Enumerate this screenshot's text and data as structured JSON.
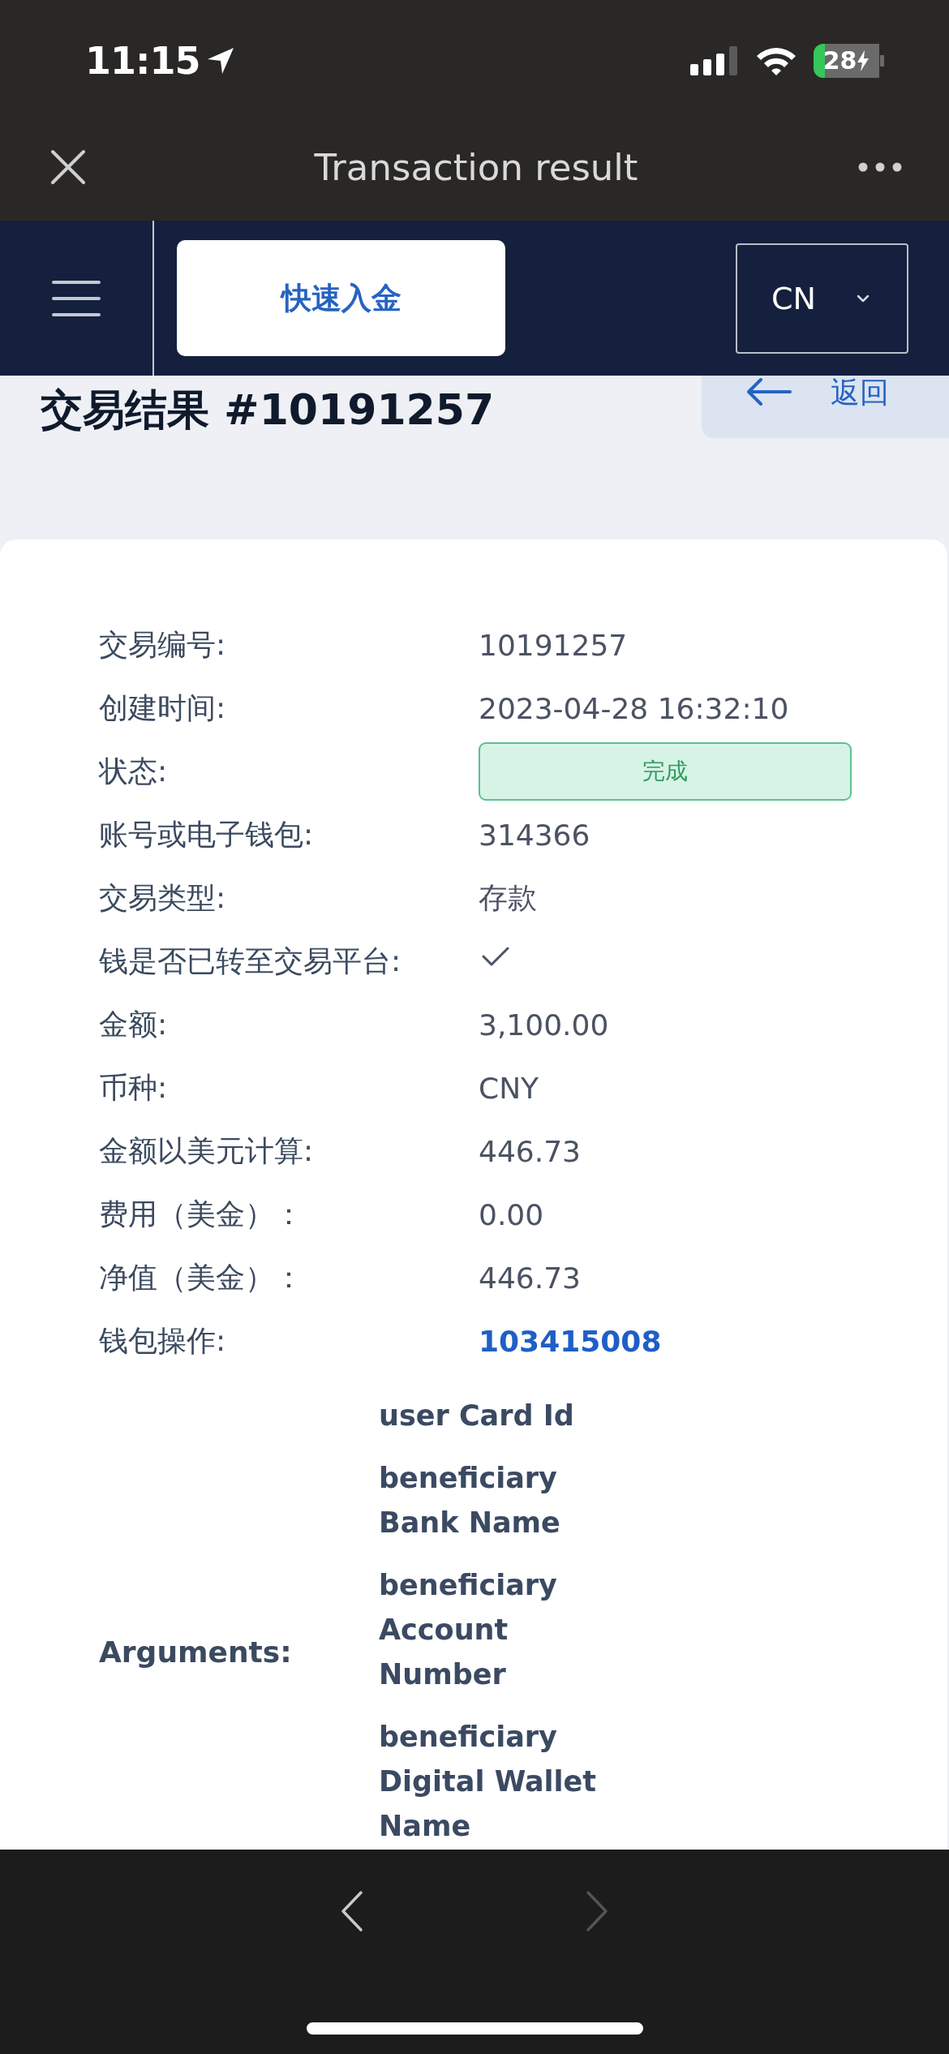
{
  "status_bar": {
    "time": "11:15",
    "battery": "28"
  },
  "title_bar": {
    "title": "Transaction result"
  },
  "nav": {
    "deposit_button": "快速入金",
    "language": "CN"
  },
  "page": {
    "heading": "交易结果 #10191257",
    "back_button": "返回"
  },
  "details": [
    {
      "kind": "text",
      "label": "交易编号:",
      "value": "10191257"
    },
    {
      "kind": "text",
      "label": "创建时间:",
      "value": "2023-04-28 16:32:10"
    },
    {
      "kind": "badge",
      "label": "状态:",
      "value": "完成"
    },
    {
      "kind": "text",
      "label": "账号或电子钱包:",
      "value": "314366"
    },
    {
      "kind": "text",
      "label": "交易类型:",
      "value": "存款"
    },
    {
      "kind": "check",
      "label": "钱是否已转至交易平台:",
      "checked": true
    },
    {
      "kind": "text",
      "label": "金额:",
      "value": "3,100.00"
    },
    {
      "kind": "text",
      "label": "币种:",
      "value": "CNY"
    },
    {
      "kind": "text",
      "label": "金额以美元计算:",
      "value": "446.73"
    },
    {
      "kind": "text",
      "label": "费用（美金）：",
      "value": "0.00"
    },
    {
      "kind": "text",
      "label": "净值（美金）：",
      "value": "446.73"
    },
    {
      "kind": "link",
      "label": "钱包操作:",
      "value": "103415008"
    }
  ],
  "arguments": {
    "label": "Arguments:",
    "items": [
      "user Card Id",
      "beneficiary Bank Name",
      "beneficiary Account Number",
      "beneficiary Digital Wallet Name"
    ]
  },
  "browser_nav": {
    "back_enabled": true,
    "forward_enabled": false
  }
}
